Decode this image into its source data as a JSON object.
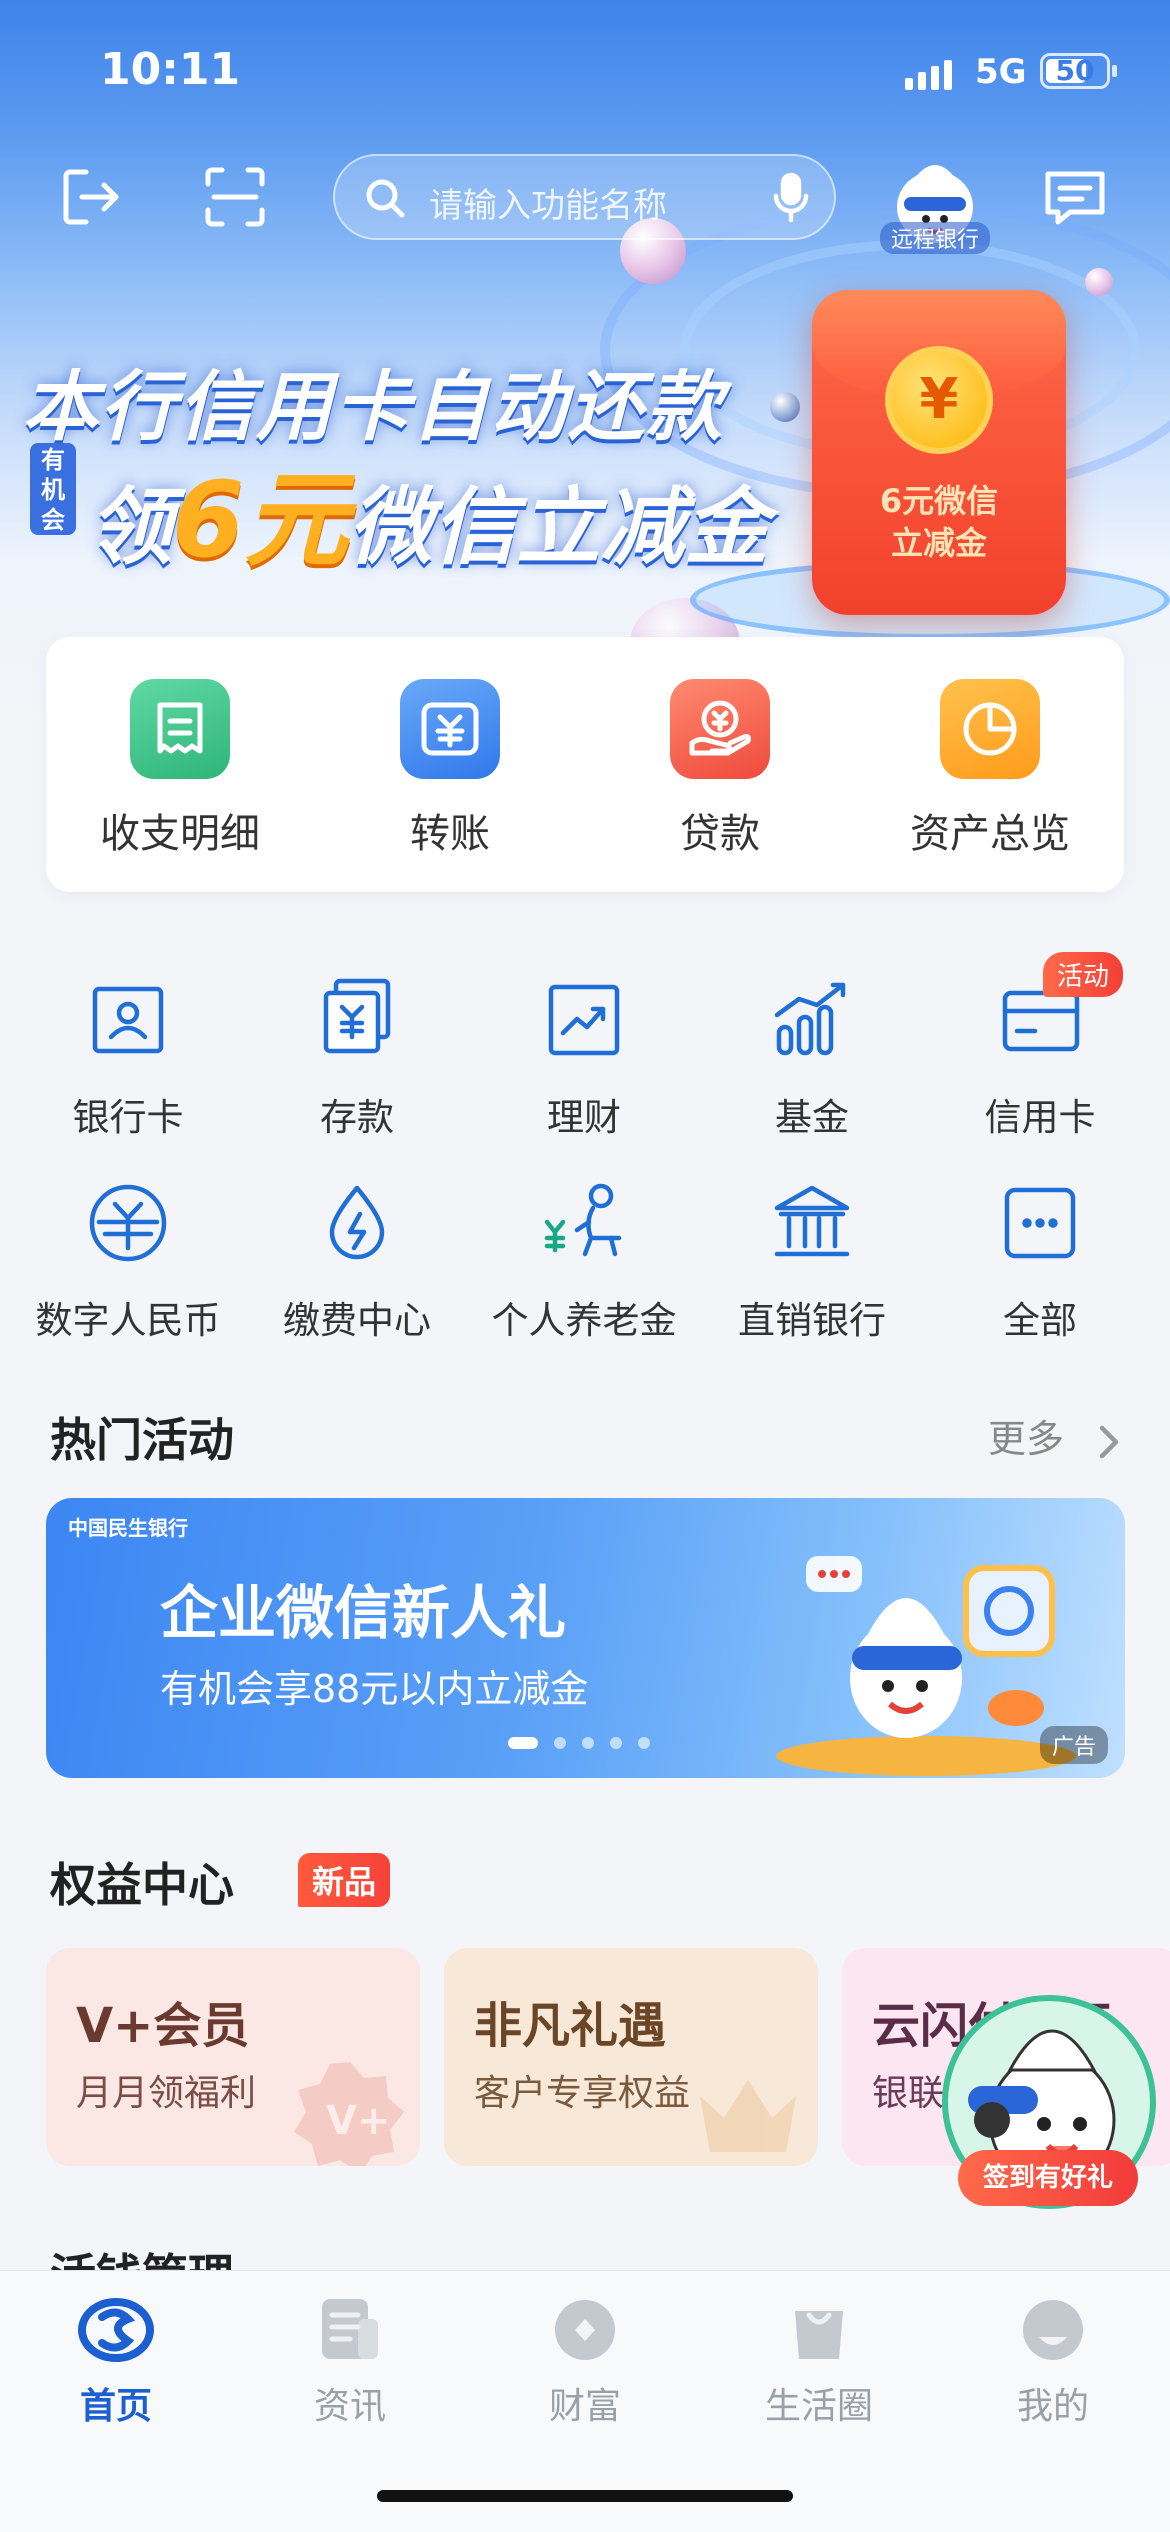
{
  "status_bar": {
    "time": "10:11",
    "network": "5G",
    "battery": "50"
  },
  "header": {
    "search_placeholder": "请输入功能名称",
    "remote_bank_label": "远程银行"
  },
  "banner": {
    "title": "本行信用卡自动还款",
    "badge": "有机会",
    "subtitle_prefix": "领",
    "subtitle_amount": "6元",
    "subtitle_suffix": "微信立减金",
    "packet_text_line1": "6元微信",
    "packet_text_line2": "立减金",
    "coin_symbol": "¥"
  },
  "quick_actions": [
    {
      "label": "收支明细",
      "icon": "statement-icon",
      "color": "#3cc28a"
    },
    {
      "label": "转账",
      "icon": "transfer-icon",
      "color": "#3a8af2"
    },
    {
      "label": "贷款",
      "icon": "loan-icon",
      "color": "#f2564a"
    },
    {
      "label": "资产总览",
      "icon": "asset-overview-icon",
      "color": "#ffa323"
    }
  ],
  "grid": [
    {
      "label": "银行卡",
      "icon": "bank-card-icon"
    },
    {
      "label": "存款",
      "icon": "deposit-icon"
    },
    {
      "label": "理财",
      "icon": "wealth-icon"
    },
    {
      "label": "基金",
      "icon": "fund-icon"
    },
    {
      "label": "信用卡",
      "icon": "credit-card-icon"
    },
    {
      "label": "数字人民币",
      "icon": "digital-rmb-icon"
    },
    {
      "label": "缴费中心",
      "icon": "payment-center-icon"
    },
    {
      "label": "个人养老金",
      "icon": "pension-icon"
    },
    {
      "label": "直销银行",
      "icon": "direct-bank-icon"
    },
    {
      "label": "全部",
      "icon": "all-icon"
    }
  ],
  "activity_tag": "活动",
  "hot": {
    "title": "热门活动",
    "more": "更多",
    "banner_logo": "中国民生银行",
    "banner_title": "企业微信新人礼",
    "banner_subtitle": "有机会享88元以内立减金",
    "ad_label": "广告"
  },
  "benefits": {
    "title": "权益中心",
    "new_tag": "新品",
    "cards": [
      {
        "title": "V+会员",
        "subtitle": "月月领福利",
        "bg": "#fbe7e4",
        "color": "#6a3a30"
      },
      {
        "title": "非凡礼遇",
        "subtitle": "客户专享权益",
        "bg": "#f8e8d8",
        "color": "#6a4526"
      },
      {
        "title": "云闪付专区",
        "subtitle": "银联优惠",
        "bg": "#fbe6f2",
        "color": "#5a2c48"
      }
    ]
  },
  "floating": {
    "label": "签到有好礼"
  },
  "next_section": "活钱管理",
  "tabbar": [
    {
      "label": "首页",
      "icon": "home-logo-icon",
      "active": true
    },
    {
      "label": "资讯",
      "icon": "news-icon",
      "active": false
    },
    {
      "label": "财富",
      "icon": "wealth-tab-icon",
      "active": false
    },
    {
      "label": "生活圈",
      "icon": "life-circle-icon",
      "active": false
    },
    {
      "label": "我的",
      "icon": "profile-icon",
      "active": false
    }
  ]
}
